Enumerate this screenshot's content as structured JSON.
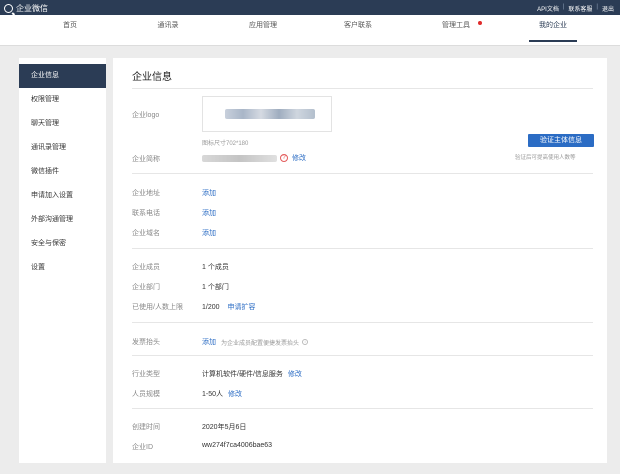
{
  "topbar": {
    "app_name": "企业微信",
    "links": [
      "API文档",
      "联系客服",
      "退出"
    ]
  },
  "nav": {
    "items": [
      {
        "label": "首页",
        "active": false
      },
      {
        "label": "通讯录",
        "active": false
      },
      {
        "label": "应用管理",
        "active": false
      },
      {
        "label": "客户联系",
        "active": false
      },
      {
        "label": "管理工具",
        "active": false,
        "badge": true
      },
      {
        "label": "我的企业",
        "active": true
      }
    ]
  },
  "sidebar": {
    "items": [
      {
        "label": "企业信息",
        "active": true
      },
      {
        "label": "权限管理",
        "active": false
      },
      {
        "label": "聊天管理",
        "active": false
      },
      {
        "label": "通讯录管理",
        "active": false
      },
      {
        "label": "微信插件",
        "active": false
      },
      {
        "label": "申请加入设置",
        "active": false
      },
      {
        "label": "外部沟通管理",
        "active": false
      },
      {
        "label": "安全与保密",
        "active": false
      },
      {
        "label": "设置",
        "active": false
      }
    ]
  },
  "main": {
    "title": "企业信息",
    "logo": {
      "label": "企业logo",
      "size_hint": "图标尺寸702*180"
    },
    "name": {
      "label": "企业简称",
      "edit": "修改"
    },
    "verify": {
      "button": "验证主体信息",
      "hint": "验证后可提高使用人数等"
    },
    "address": {
      "label": "企业地址",
      "action": "添加"
    },
    "phone": {
      "label": "联系电话",
      "action": "添加"
    },
    "domain": {
      "label": "企业域名",
      "action": "添加"
    },
    "members": {
      "label": "企业成员",
      "value": "1 个成员"
    },
    "departments": {
      "label": "企业部门",
      "value": "1 个部门"
    },
    "limit": {
      "label": "已使用/人数上限",
      "value": "1/200",
      "action": "申请扩容"
    },
    "invoice": {
      "label": "发票抬头",
      "action": "添加",
      "hint": "为企业成员配置便捷发票抬头"
    },
    "industry": {
      "label": "行业类型",
      "value": "计算机软件/硬件/信息服务",
      "edit": "修改"
    },
    "staff": {
      "label": "人员规模",
      "value": "1-50人",
      "edit": "修改"
    },
    "created": {
      "label": "创建时间",
      "value": "2020年5月6日"
    },
    "corp_id": {
      "label": "企业ID",
      "value": "ww274f7ca4006bae63"
    }
  }
}
